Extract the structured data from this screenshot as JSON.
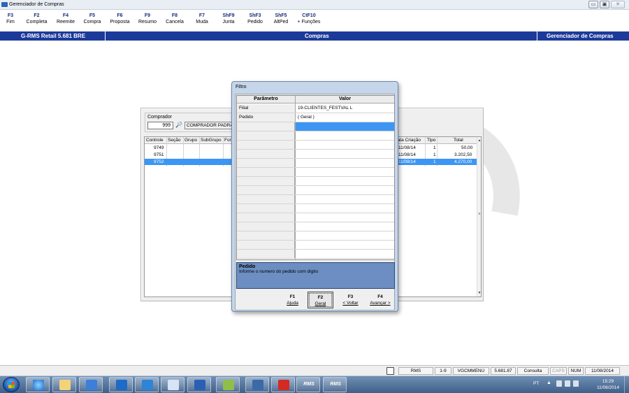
{
  "window": {
    "title": "Gerenciador de Compras",
    "controls": {
      "minimize": "▭",
      "maximize": "▣",
      "close": "✕"
    }
  },
  "toolbar": {
    "items": [
      {
        "key": "F3",
        "label": "Fim"
      },
      {
        "key": "F2",
        "label": "Completa"
      },
      {
        "key": "F4",
        "label": "Reemite"
      },
      {
        "key": "F5",
        "label": "Compra"
      },
      {
        "key": "F6",
        "label": "Proposta"
      },
      {
        "key": "F9",
        "label": "Resumo"
      },
      {
        "key": "F8",
        "label": "Cancela"
      },
      {
        "key": "F7",
        "label": "Muda"
      },
      {
        "key": "ShF9",
        "label": "Junta"
      },
      {
        "key": "ShF3",
        "label": "Pedido"
      },
      {
        "key": "ShF5",
        "label": "AltPed"
      },
      {
        "key": "CtF10",
        "label": "+ Funções"
      }
    ]
  },
  "strip": {
    "left": "G-RMS Retail 5.681 BRE",
    "center": "Compras",
    "right": "Gerenciador de Compras"
  },
  "comprador": {
    "label": "Comprador",
    "code": "999",
    "name": "COMPRADOR PADRÃO"
  },
  "grid": {
    "headers": {
      "controle": "Controle",
      "secao": "Seção",
      "grupo": "Grupo",
      "subgrupo": "SubGrupo",
      "fornecedor": "For",
      "data_criacao": "Data Criação",
      "tipo": "Tipo",
      "total": "Total"
    },
    "rows": [
      {
        "controle": "9749",
        "data": "11/08/14",
        "tipo": "1",
        "total": "50,00"
      },
      {
        "controle": "9751",
        "data": "11/08/14",
        "tipo": "1",
        "total": "3.202,50"
      },
      {
        "controle": "9752",
        "data": "11/08/14",
        "tipo": "1",
        "total": "4.270,00"
      }
    ],
    "scroll": {
      "up": "▲",
      "mid": "≡",
      "down": "▼"
    }
  },
  "dialog": {
    "title": "Filtro",
    "col_param": "Parâmetro",
    "col_value": "Valor",
    "rows": [
      {
        "param": "Filial",
        "value": "19-CLIENTES_FESTVAL L"
      },
      {
        "param": "Pedido",
        "value": "( Geral )"
      }
    ],
    "help_title": "Pedido",
    "help_text": "Informe o numero do pedido com digito",
    "buttons": [
      {
        "key": "F1",
        "label": "Ajuda"
      },
      {
        "key": "F2",
        "label": "Geral"
      },
      {
        "key": "F3",
        "label": "< Voltar"
      },
      {
        "key": "F4",
        "label": "Avançar >"
      }
    ]
  },
  "statusbar": {
    "cells": [
      "RMS",
      "1-9",
      "VGCMMENU",
      "5.681.87",
      "Consulta",
      "CAPS",
      "NUM",
      "11/08/2014"
    ]
  },
  "taskbar": {
    "rms1": "RMS",
    "rms2": "RMS",
    "lang": "PT",
    "time": "15:29",
    "date": "11/08/2014"
  }
}
